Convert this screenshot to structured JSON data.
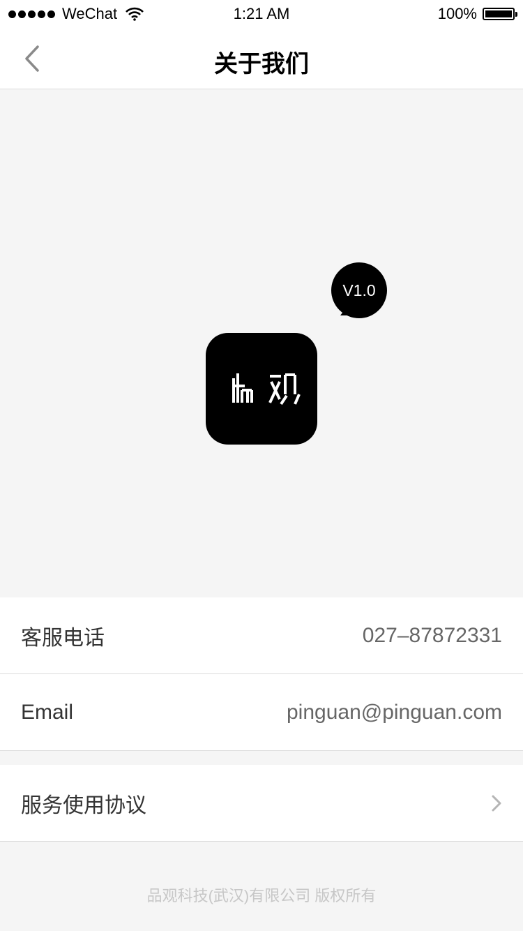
{
  "status_bar": {
    "carrier": "WeChat",
    "time": "1:21 AM",
    "battery": "100%",
    "signal_icon": "signal-dots-icon",
    "wifi_icon": "wifi-icon",
    "battery_icon": "battery-full-icon"
  },
  "nav": {
    "title": "关于我们",
    "back_icon": "back-arrow-icon"
  },
  "hero": {
    "version": "V1.0",
    "logo_icon": "pinguan-app-logo"
  },
  "contact": {
    "phone_label": "客服电话",
    "phone_value": "027–87872331",
    "email_label": "Email",
    "email_value": "pinguan@pinguan.com"
  },
  "agreement": {
    "label": "服务使用协议",
    "chevron_icon": "chevron-right-icon"
  },
  "footer": {
    "copyright": "品观科技(武汉)有限公司 版权所有"
  },
  "colors": {
    "background": "#f5f5f5",
    "surface": "#ffffff",
    "divider": "#dcdcdc",
    "text_primary": "#333333",
    "text_secondary": "#666666",
    "footer_text": "#c7c7c7",
    "brand": "#000000"
  }
}
